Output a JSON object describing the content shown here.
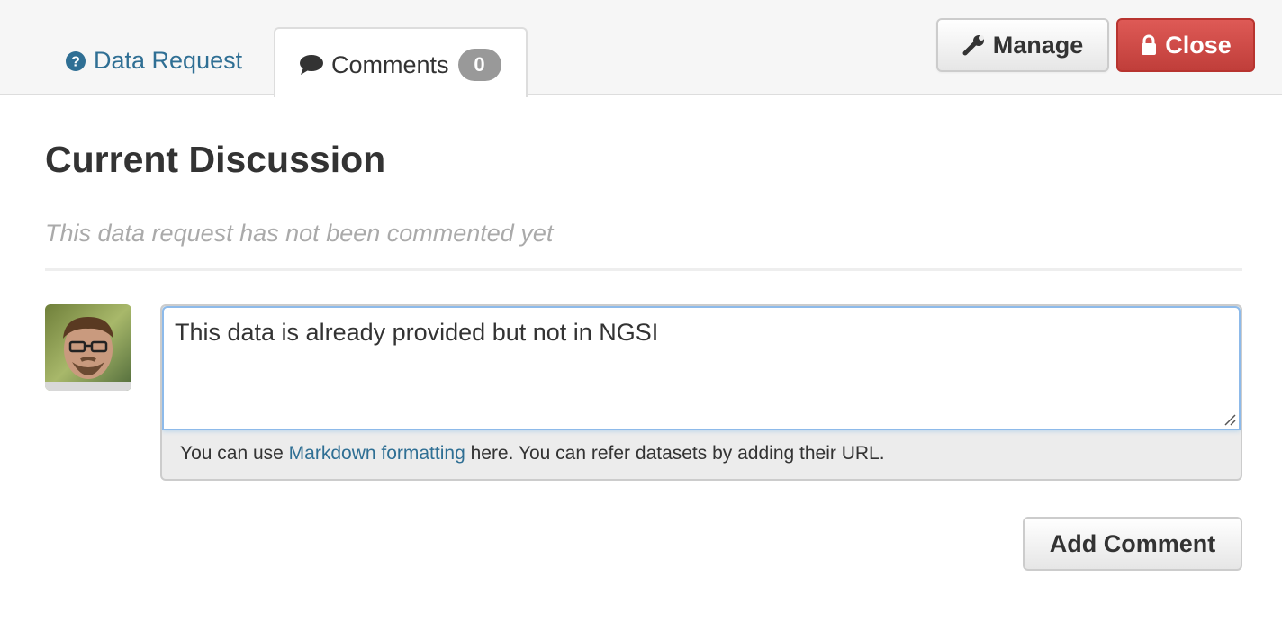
{
  "tabs": {
    "data_request": {
      "label": "Data Request",
      "icon": "question-circle-icon"
    },
    "comments": {
      "label": "Comments",
      "count": "0",
      "icon": "speech-bubble-icon"
    }
  },
  "actions": {
    "manage_label": "Manage",
    "manage_icon": "wrench-icon",
    "close_label": "Close",
    "close_icon": "lock-icon"
  },
  "discussion": {
    "title": "Current Discussion",
    "empty_message": "This data request has not been commented yet"
  },
  "comment_form": {
    "avatar_icon": "user-avatar",
    "value": "This data is already provided but not in NGSI",
    "help_prefix": "You can use ",
    "help_link": "Markdown formatting",
    "help_suffix": " here. You can refer datasets by adding their URL.",
    "submit_label": "Add Comment"
  },
  "colors": {
    "link": "#2f6f94",
    "danger": "#c9433f",
    "badge": "#999999",
    "focus": "#8dbaea"
  }
}
